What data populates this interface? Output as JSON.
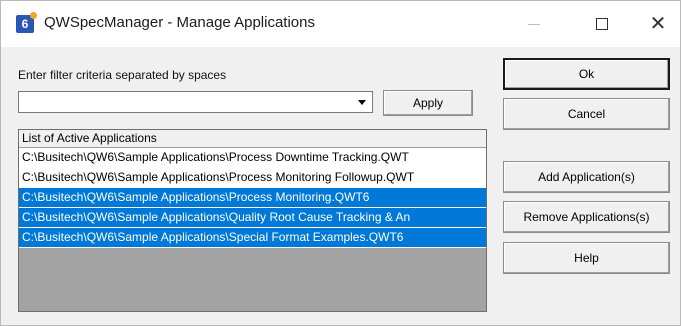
{
  "window": {
    "title": "QWSpecManager - Manage Applications",
    "icon": "app-logo-icon",
    "controls": {
      "minimize_icon": "minimize-icon",
      "maximize_icon": "maximize-icon",
      "close_glyph": "✕"
    }
  },
  "filter": {
    "label": "Enter filter criteria separated by spaces",
    "value": "",
    "apply_label": "Apply"
  },
  "list": {
    "header": "List of Active Applications",
    "items": [
      {
        "text": "C:\\Busitech\\QW6\\Sample Applications\\Process Downtime Tracking.QWT",
        "selected": false
      },
      {
        "text": "C:\\Busitech\\QW6\\Sample Applications\\Process Monitoring Followup.QWT",
        "selected": false
      },
      {
        "text": "C:\\Busitech\\QW6\\Sample Applications\\Process Monitoring.QWT6",
        "selected": true
      },
      {
        "text": "C:\\Busitech\\QW6\\Sample Applications\\Quality Root Cause Tracking & An",
        "selected": true
      },
      {
        "text": "C:\\Busitech\\QW6\\Sample Applications\\Special Format Examples.QWT6",
        "selected": true
      }
    ]
  },
  "buttons": {
    "ok": "Ok",
    "cancel": "Cancel",
    "add": "Add Application(s)",
    "remove": "Remove Applications(s)",
    "help": "Help"
  },
  "colors": {
    "selection": "#0078d7",
    "dialog_background": "#f0f0f0",
    "list_empty_area": "#a3a3a3"
  }
}
